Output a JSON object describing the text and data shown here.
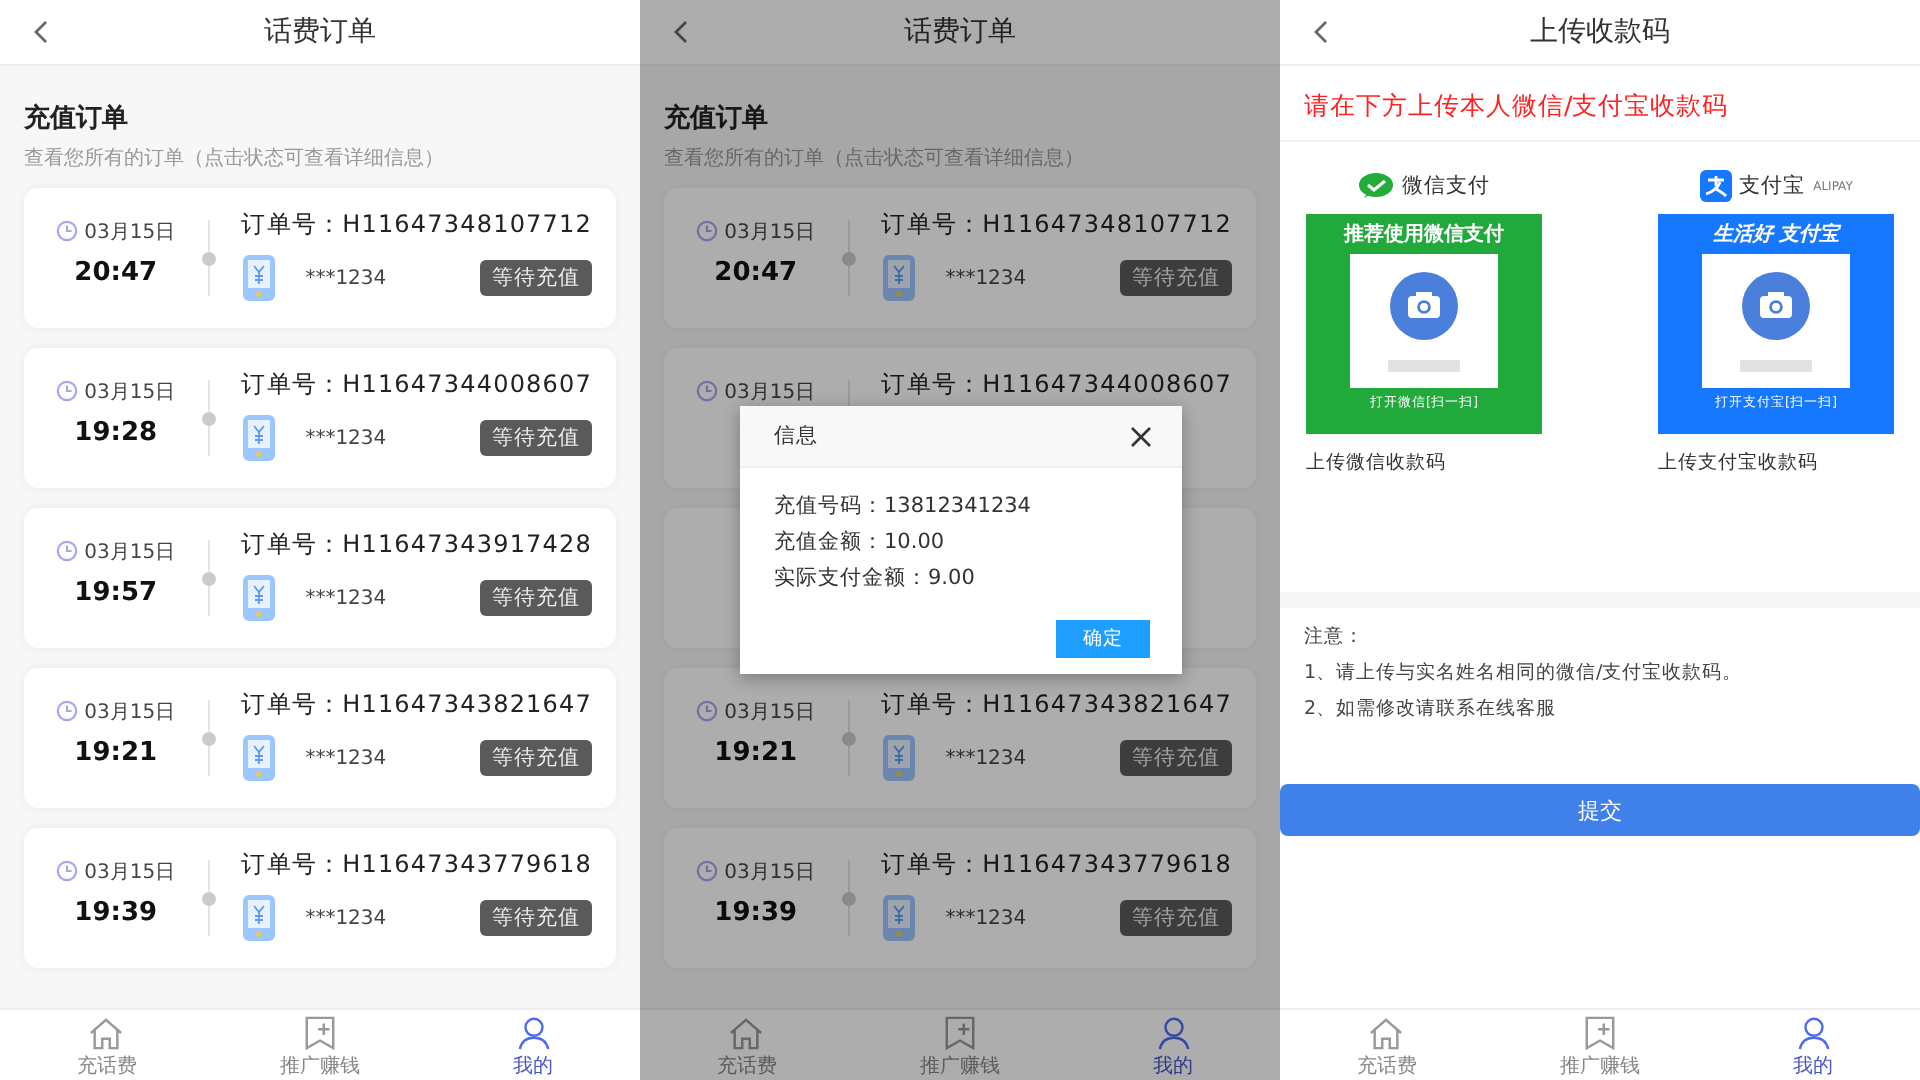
{
  "screens": [
    {
      "kind": "orders",
      "title": "话费订单",
      "section_title": "充值订单",
      "section_subtitle": "查看您所有的订单（点击状态可查看详细信息）",
      "orders": [
        {
          "date": "03月15日",
          "time": "20:47",
          "order_no": "订单号：H11647348107712",
          "phone": "***1234",
          "status": "等待充值"
        },
        {
          "date": "03月15日",
          "time": "19:28",
          "order_no": "订单号：H11647344008607",
          "phone": "***1234",
          "status": "等待充值"
        },
        {
          "date": "03月15日",
          "time": "19:57",
          "order_no": "订单号：H11647343917428",
          "phone": "***1234",
          "status": "等待充值"
        },
        {
          "date": "03月15日",
          "time": "19:21",
          "order_no": "订单号：H11647343821647",
          "phone": "***1234",
          "status": "等待充值"
        },
        {
          "date": "03月15日",
          "time": "19:39",
          "order_no": "订单号：H11647343779618",
          "phone": "***1234",
          "status": "等待充值"
        }
      ],
      "tab_bar": [
        {
          "label": "充话费",
          "selected": false
        },
        {
          "label": "推广赚钱",
          "selected": false
        },
        {
          "label": "我的",
          "selected": true
        }
      ]
    },
    {
      "kind": "orders",
      "title": "话费订单",
      "section_title": "充值订单",
      "section_subtitle": "查看您所有的订单（点击状态可查看详细信息）",
      "orders": [
        {
          "kind": "order",
          "date": "03月15日",
          "time": "20:47",
          "order_no": "订单号：H11647348107712",
          "phone": "***1234",
          "status": "等待充值"
        },
        {
          "kind": "order",
          "date": "03月15日",
          "order_no": "订单号：H11647344008607"
        },
        {
          "kind": "covered"
        },
        {
          "kind": "order",
          "date": "03月15日",
          "time": "19:21",
          "order_no": "订单号：H11647343821647",
          "phone": "***1234",
          "status": "等待充值"
        },
        {
          "kind": "order",
          "date": "03月15日",
          "time": "19:39",
          "order_no": "订单号：H11647343779618",
          "phone": "***1234",
          "status": "等待充值"
        }
      ],
      "tab_bar": [
        {
          "label": "充话费",
          "selected": false
        },
        {
          "label": "推广赚钱",
          "selected": false
        },
        {
          "label": "我的",
          "selected": true
        }
      ],
      "dialog": {
        "title": "信息",
        "lines": [
          "充值号码：13812341234",
          "充值金额：10.00",
          "实际支付金额：9.00"
        ],
        "button": "确定"
      }
    },
    {
      "kind": "upload",
      "title": "上传收款码",
      "notice": "请在下方上传本人微信/支付宝收款码",
      "codes": [
        {
          "kind": "wechat",
          "brand": "微信支付",
          "banner": "推荐使用微信支付",
          "hint": "打开微信[扫一扫]",
          "caption": "上传微信收款码"
        },
        {
          "kind": "alipay",
          "brand": "支付宝",
          "brand_sub": "ALIPAY",
          "banner": "生活好 支付宝",
          "hint": "打开支付宝[扫一扫]",
          "caption": "上传支付宝收款码"
        }
      ],
      "notes_title": "注意：",
      "notes": [
        "1、请上传与实名姓名相同的微信/支付宝收款码。",
        "2、如需修改请联系在线客服"
      ],
      "submit": "提交",
      "tab_bar": [
        {
          "label": "充话费",
          "selected": false
        },
        {
          "label": "推广赚钱",
          "selected": false
        },
        {
          "label": "我的",
          "selected": true
        }
      ]
    }
  ]
}
